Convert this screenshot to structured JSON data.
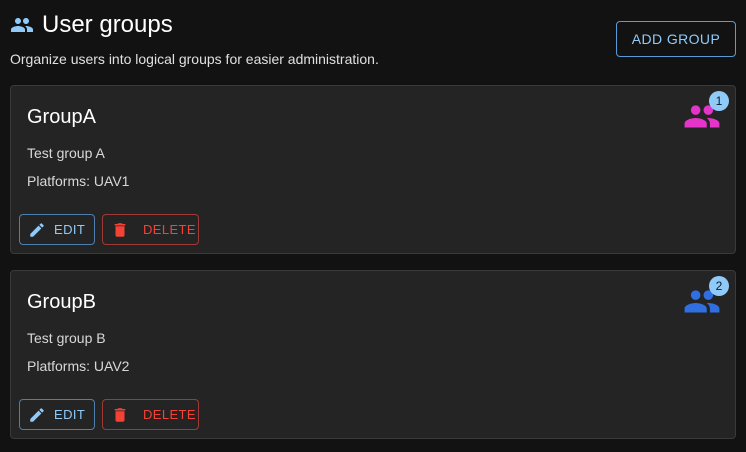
{
  "header": {
    "title": "User groups",
    "subtitle": "Organize users into logical groups for easier administration.",
    "add_button_label": "ADD GROUP",
    "title_icon": "group-icon"
  },
  "groups": [
    {
      "name": "GroupA",
      "description": "Test group A",
      "platforms": "Platforms: UAV1",
      "member_count": "1",
      "icon": "group-icon",
      "icon_color": "#e535c9",
      "edit_label": "EDIT",
      "delete_label": "DELETE"
    },
    {
      "name": "GroupB",
      "description": "Test group B",
      "platforms": "Platforms: UAV2",
      "member_count": "2",
      "icon": "group-icon",
      "icon_color": "#2f6fe0",
      "edit_label": "EDIT",
      "delete_label": "DELETE"
    }
  ],
  "colors": {
    "background": "#121212",
    "card": "#242424",
    "primary": "#90caf9",
    "error": "#f44336",
    "badge": "#90caf9"
  }
}
